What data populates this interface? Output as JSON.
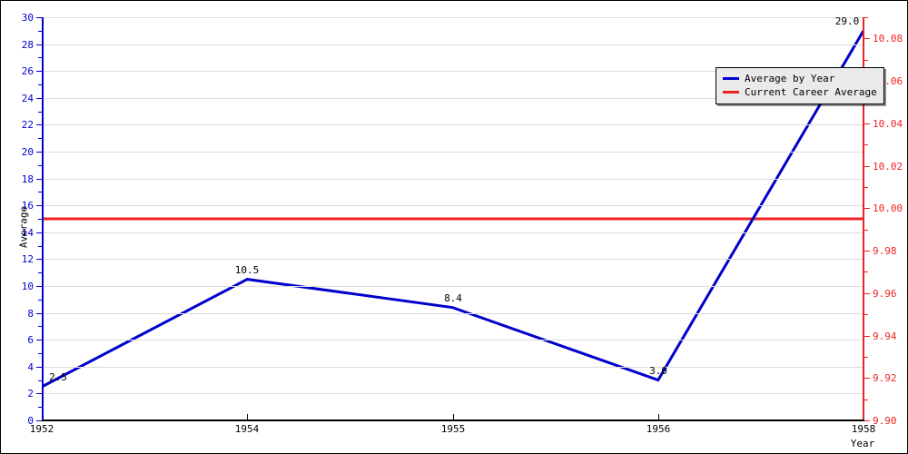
{
  "chart_data": {
    "type": "line",
    "title": "",
    "xlabel": "Year",
    "ylabel": "Average",
    "y2label": "",
    "x": [
      1952,
      1954,
      1955,
      1956,
      1958
    ],
    "xlim": [
      1952,
      1958
    ],
    "ylim": [
      0,
      30
    ],
    "y2lim": [
      9.9,
      10.09
    ],
    "grid": true,
    "legend_position": "upper right",
    "xtick_labels": [
      "1952",
      "1954",
      "1955",
      "1956",
      "1958"
    ],
    "ytick_labels": [
      "0",
      "2",
      "4",
      "6",
      "8",
      "10",
      "12",
      "14",
      "16",
      "18",
      "20",
      "22",
      "24",
      "26",
      "28",
      "30"
    ],
    "ytick_values": [
      0,
      2,
      4,
      6,
      8,
      10,
      12,
      14,
      16,
      18,
      20,
      22,
      24,
      26,
      28,
      30
    ],
    "y2tick_labels": [
      "9.90",
      "9.92",
      "9.94",
      "9.96",
      "9.98",
      "10.00",
      "10.02",
      "10.04",
      "10.06",
      "10.08"
    ],
    "y2tick_values": [
      9.9,
      9.92,
      9.94,
      9.96,
      9.98,
      10.0,
      10.02,
      10.04,
      10.06,
      10.08
    ],
    "series": [
      {
        "name": "Average by Year",
        "color": "#0000cc",
        "type": "line",
        "values": [
          2.5,
          10.5,
          8.4,
          3.0,
          29.0
        ],
        "point_labels": [
          "2.5",
          "10.5",
          "8.4",
          "3.0",
          "29.0"
        ]
      },
      {
        "name": "Current Career Average",
        "color": "#ee2222",
        "type": "hline",
        "value": 15.0
      }
    ]
  },
  "legend": {
    "items": [
      {
        "label": "Average by Year",
        "color": "#0000cc"
      },
      {
        "label": "Current Career Average",
        "color": "#ee2222"
      }
    ]
  },
  "axes": {
    "y_left": {
      "title": "Average",
      "color": "#0000cc",
      "ticks": [
        "30",
        "28",
        "26",
        "24",
        "22",
        "20",
        "18",
        "16",
        "14",
        "12",
        "10",
        "8",
        "6",
        "4",
        "2",
        "0"
      ]
    },
    "y_right": {
      "color": "#ee2222",
      "ticks": [
        "10.08",
        "10.06",
        "10.04",
        "10.02",
        "10.00",
        "9.98",
        "9.96",
        "9.94",
        "9.92",
        "9.90"
      ]
    },
    "x_bottom": {
      "title": "Year",
      "color": "#000000",
      "ticks": [
        "1952",
        "1954",
        "1955",
        "1956",
        "1958"
      ]
    }
  },
  "point_labels": {
    "p1952": "2.5",
    "p1954": "10.5",
    "p1955": "8.4",
    "p1956": "3.0",
    "p1958": "29.0"
  }
}
